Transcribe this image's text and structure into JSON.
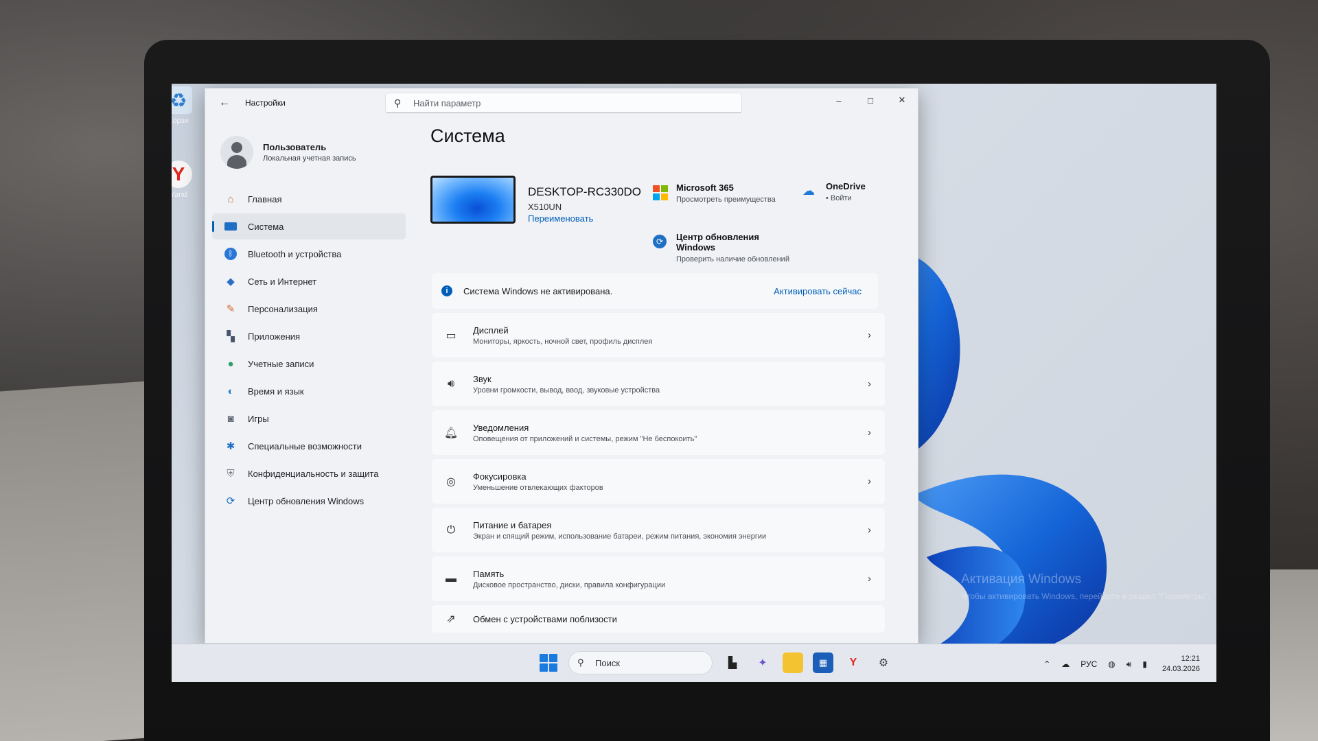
{
  "window": {
    "app_title": "Настройки",
    "search_placeholder": "Найти параметр",
    "controls": {
      "minimize": "–",
      "maximize": "□",
      "close": "✕"
    }
  },
  "user": {
    "name": "Пользователь",
    "account_type": "Локальная учетная запись"
  },
  "sidebar": {
    "items": [
      {
        "label": "Главная",
        "icon": "home-icon",
        "active": false
      },
      {
        "label": "Система",
        "icon": "monitor-icon",
        "active": true
      },
      {
        "label": "Bluetooth и устройства",
        "icon": "bluetooth-icon",
        "active": false
      },
      {
        "label": "Сеть и Интернет",
        "icon": "wifi-icon",
        "active": false
      },
      {
        "label": "Персонализация",
        "icon": "brush-icon",
        "active": false
      },
      {
        "label": "Приложения",
        "icon": "apps-icon",
        "active": false
      },
      {
        "label": "Учетные записи",
        "icon": "person-icon",
        "active": false
      },
      {
        "label": "Время и язык",
        "icon": "globe-clock-icon",
        "active": false
      },
      {
        "label": "Игры",
        "icon": "gamepad-icon",
        "active": false
      },
      {
        "label": "Специальные возможности",
        "icon": "accessibility-icon",
        "active": false
      },
      {
        "label": "Конфиденциальность и защита",
        "icon": "shield-icon",
        "active": false
      },
      {
        "label": "Центр обновления Windows",
        "icon": "update-icon",
        "active": false
      }
    ]
  },
  "main": {
    "title": "Система",
    "device": {
      "name": "DESKTOP-RC330DO",
      "model": "X510UN",
      "rename_label": "Переименовать"
    },
    "quick_links": [
      {
        "title": "Microsoft 365",
        "subtitle": "Просмотреть преимущества",
        "icon": "microsoft365-icon"
      },
      {
        "title": "OneDrive",
        "subtitle": "• Войти",
        "icon": "onedrive-icon"
      },
      {
        "title": "Центр обновления Windows",
        "subtitle": "Проверить наличие обновлений",
        "icon": "update-icon"
      }
    ],
    "activation_banner": {
      "text": "Система Windows не активирована.",
      "link": "Активировать сейчас"
    },
    "cards": [
      {
        "title": "Дисплей",
        "subtitle": "Мониторы, яркость, ночной свет, профиль дисплея",
        "icon": "display-icon"
      },
      {
        "title": "Звук",
        "subtitle": "Уровни громкости, вывод, ввод, звуковые устройства",
        "icon": "speaker-icon"
      },
      {
        "title": "Уведомления",
        "subtitle": "Оповещения от приложений и системы, режим \"Не беспокоить\"",
        "icon": "bell-icon"
      },
      {
        "title": "Фокусировка",
        "subtitle": "Уменьшение отвлекающих факторов",
        "icon": "focus-icon"
      },
      {
        "title": "Питание и батарея",
        "subtitle": "Экран и спящий режим, использование батареи, режим питания, экономия энергии",
        "icon": "power-icon"
      },
      {
        "title": "Память",
        "subtitle": "Дисковое пространство, диски, правила конфигурации",
        "icon": "storage-icon"
      },
      {
        "title": "Обмен с устройствами поблизости",
        "subtitle": "",
        "icon": "share-icon"
      }
    ]
  },
  "desktop": {
    "icons": [
      {
        "label": "Корзи",
        "icon": "recycle-bin-icon"
      },
      {
        "label": "Yand",
        "icon": "yandex-browser-icon"
      }
    ],
    "watermark_title": "Активация Windows",
    "watermark_text": "Чтобы активировать Windows, перейдите в раздел \"Параметры\"."
  },
  "taskbar": {
    "search_label": "Поиск",
    "apps": [
      "task-view-icon",
      "copilot-icon",
      "file-explorer-icon",
      "store-icon",
      "yandex-icon",
      "settings-icon"
    ],
    "language": "РУС",
    "time": "12:21",
    "date": "24.03.2026"
  },
  "colors": {
    "accent": "#005fb8",
    "window_bg": "#f0f2f6",
    "card_bg": "#f8f9fb",
    "wallpaper_blue": "#1565d8"
  }
}
